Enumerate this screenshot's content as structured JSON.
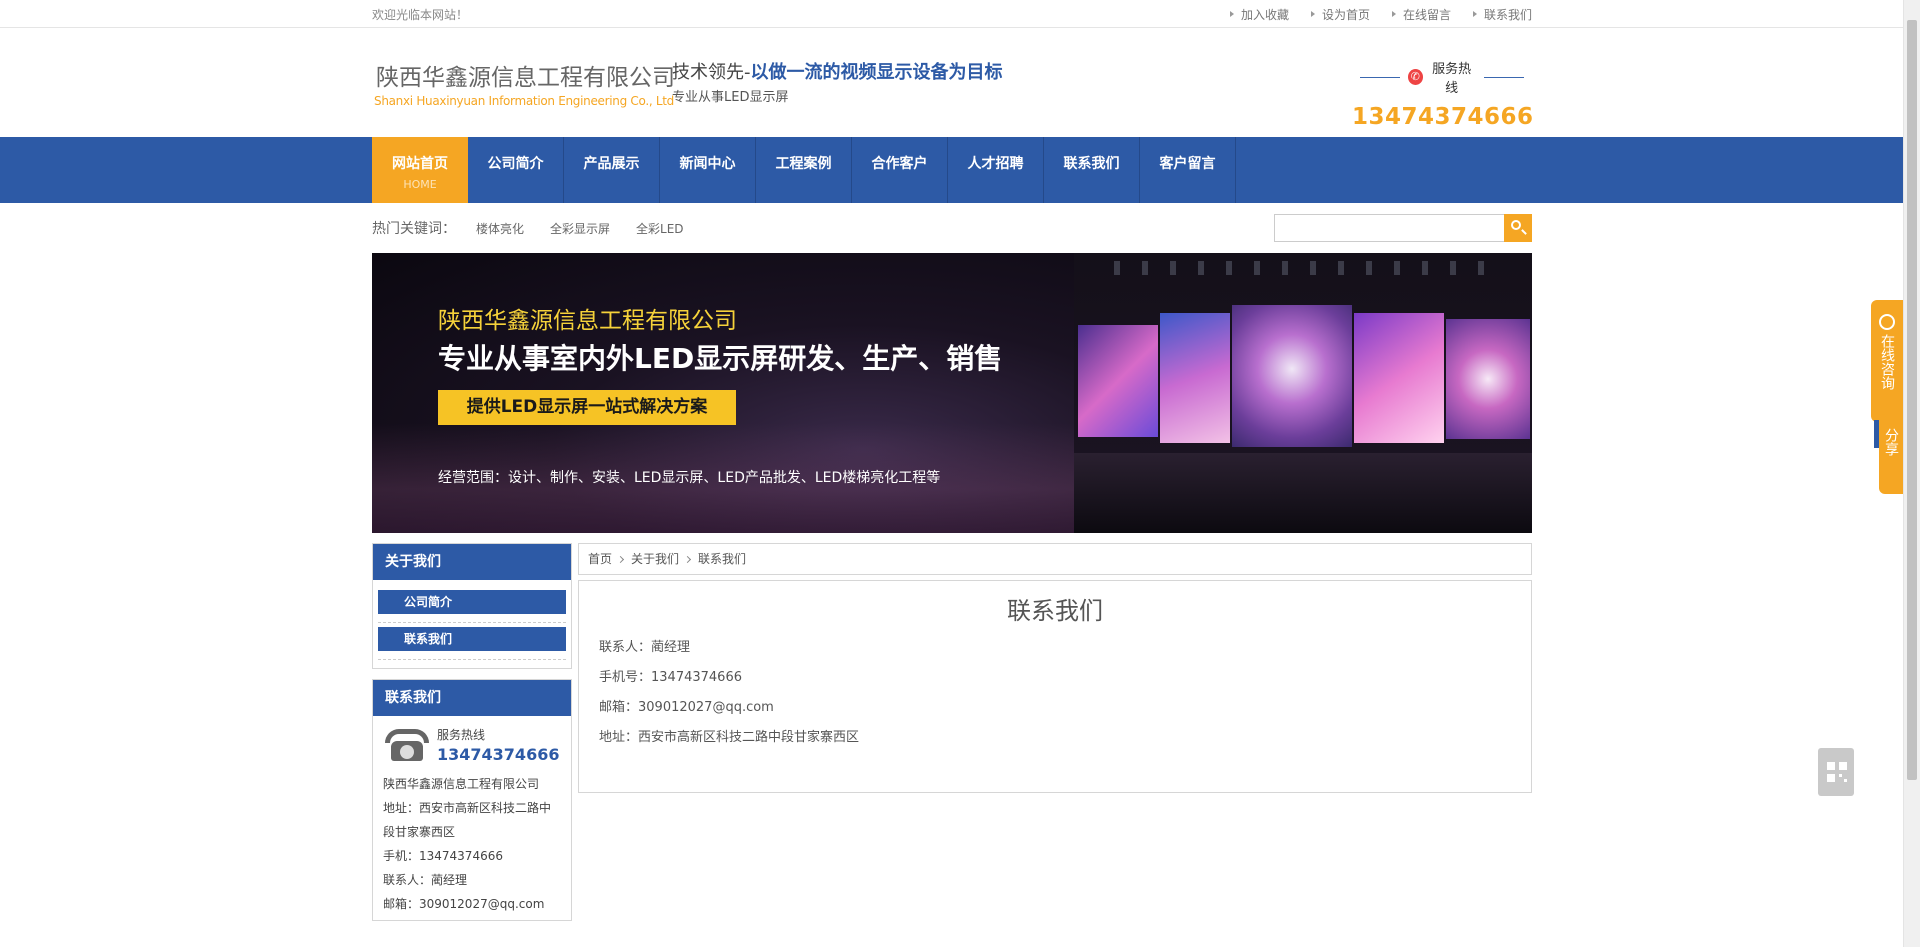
{
  "topbar": {
    "welcome": "欢迎光临本网站！",
    "links": [
      "加入收藏",
      "设为首页",
      "在线留言",
      "联系我们"
    ]
  },
  "header": {
    "company_cn": "陕西华鑫源信息工程有限公司",
    "company_en": "Shanxi  Huaxinyuan Information Engineering Co., Ltd",
    "slogan_prefix": "技术领先-",
    "slogan_bold": "以做一流的视频显示设备为目标",
    "slogan_sub": "专业从事LED显示屏",
    "hotline_label": "服务热线",
    "hotline_number": "13474374666"
  },
  "nav": {
    "items": [
      "网站首页",
      "公司简介",
      "产品展示",
      "新闻中心",
      "工程案例",
      "合作客户",
      "人才招聘",
      "联系我们",
      "客户留言"
    ],
    "home_sub": "HOME"
  },
  "keywords": {
    "title": "热门关键词：",
    "items": [
      "楼体亮化",
      "全彩显示屏",
      "全彩LED"
    ]
  },
  "search": {
    "placeholder": ""
  },
  "banner": {
    "company": "陕西华鑫源信息工程有限公司",
    "headline": "专业从事室内外LED显示屏研发、生产、销售",
    "tag": "提供LED显示屏一站式解决方案",
    "scope": "经营范围：设计、制作、安装、LED显示屏、LED产品批发、LED楼梯亮化工程等"
  },
  "sidebar": {
    "about_title": "关于我们",
    "about_links": [
      "公司简介",
      "联系我们"
    ],
    "contact_title": "联系我们",
    "hot_label": "服务热线",
    "hot_number": "13474374666",
    "lines": [
      "陕西华鑫源信息工程有限公司",
      "地址：西安市高新区科技二路中",
      "段甘家寨西区",
      "手机：13474374666",
      "联系人：蔺经理",
      "邮箱：309012027@qq.com"
    ]
  },
  "breadcrumb": [
    "首页",
    "关于我们",
    "联系我们"
  ],
  "panel": {
    "title": "联系我们",
    "lines": [
      "联系人：蔺经理",
      "手机号：13474374666",
      "邮箱：309012027@qq.com",
      "地址：西安市高新区科技二路中段甘家寨西区"
    ]
  },
  "floats": {
    "consult": "在线咨询",
    "share": "分享"
  },
  "colors": {
    "brand_blue": "#2d5aa6",
    "accent_orange": "#f5a623",
    "banner_yellow": "#f6c325"
  }
}
